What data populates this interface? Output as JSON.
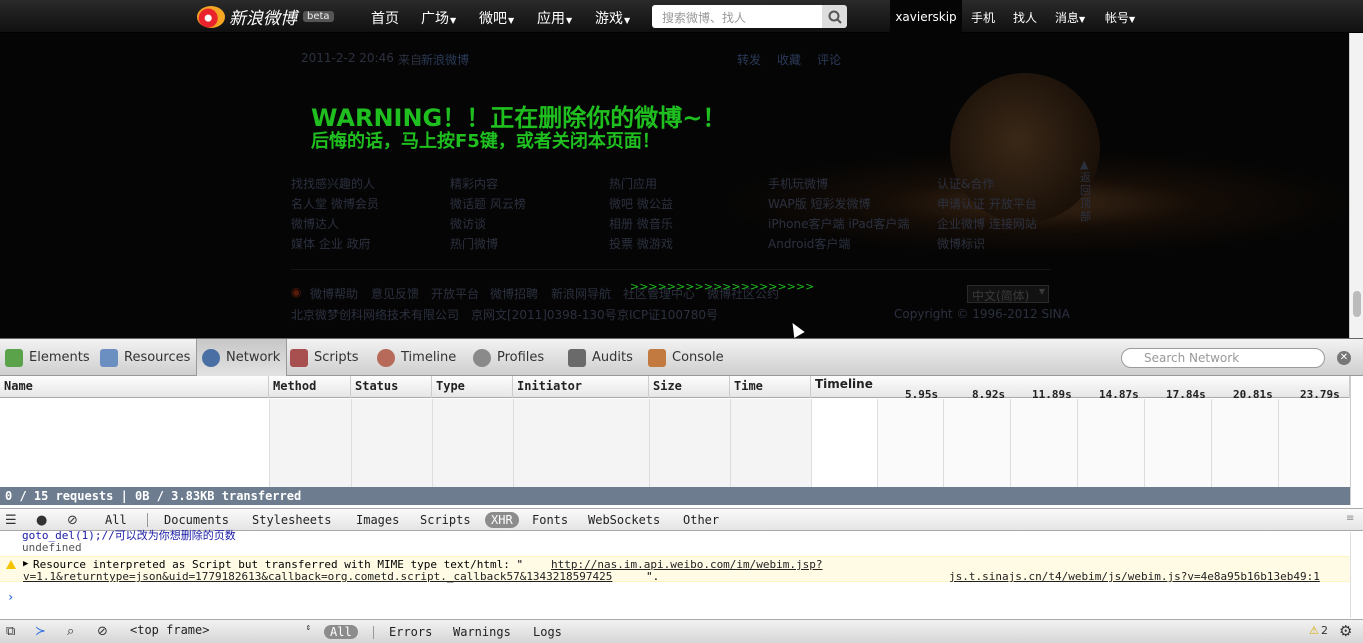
{
  "topbar": {
    "brand": "新浪微博",
    "beta": "beta",
    "nav": [
      "首页",
      "广场",
      "微吧",
      "应用",
      "游戏"
    ],
    "search_placeholder": "搜索微博、找人",
    "username": "xavierskip",
    "right_links": [
      "手机",
      "找人",
      "消息",
      "帐号"
    ]
  },
  "page": {
    "post_meta": {
      "time": "2011-2-2 20:46",
      "from_prefix": "来自",
      "from_source": "新浪微博",
      "actions": [
        "转发",
        "收藏",
        "评论"
      ]
    },
    "warning_line1": "WARNING！！正在删除你的微博~！",
    "warning_line2": "后悔的话，马上按F5键，或者关闭本页面！",
    "footer_columns": [
      {
        "title": "找找感兴趣的人",
        "lines": [
          "名人堂 微博会员",
          "微博达人",
          "媒体 企业 政府"
        ]
      },
      {
        "title": "精彩内容",
        "lines": [
          "微话题 风云榜",
          "微访谈",
          "热门微博"
        ]
      },
      {
        "title": "热门应用",
        "lines": [
          "微吧 微公益",
          "相册 微音乐",
          "投票 微游戏"
        ]
      },
      {
        "title": "手机玩微博",
        "lines": [
          "WAP版 短彩发微博",
          "iPhone客户端 iPad客户端",
          "Android客户端"
        ]
      },
      {
        "title": "认证&合作",
        "lines": [
          "申请认证 开放平台",
          "企业微博 连接网站",
          "微博标识"
        ]
      }
    ],
    "back_to_top": "返回顶部",
    "footer_links": [
      "微博帮助",
      "意见反馈",
      "开放平台",
      "微博招聘",
      "新浪网导航",
      "社区管理中心",
      "微博社区公约"
    ],
    "arrows": ">>>>>>>>>>>>>>>>>>>>",
    "language": "中文(简体)",
    "company": "北京微梦创科网络技术有限公司",
    "license1": "京网文[2011]0398-130号",
    "license2": "京ICP证100780号",
    "copyright": "Copyright © 1996-2012 SINA"
  },
  "devtools": {
    "tabs": [
      "Elements",
      "Resources",
      "Network",
      "Scripts",
      "Timeline",
      "Profiles",
      "Audits",
      "Console"
    ],
    "active_tab": "Network",
    "search_placeholder": "Search Network",
    "columns": [
      "Name",
      "Method",
      "Status",
      "Type",
      "Initiator",
      "Size",
      "Time",
      "Timeline"
    ],
    "timeline_ticks": [
      "5.95s",
      "8.92s",
      "11.89s",
      "14.87s",
      "17.84s",
      "20.81s",
      "23.79s"
    ],
    "status": "0 / 15 requests  |  0B / 3.83KB transferred",
    "filters": [
      "All",
      "Documents",
      "Stylesheets",
      "Images",
      "Scripts",
      "XHR",
      "Fonts",
      "WebSockets",
      "Other"
    ],
    "selected_filter": "XHR",
    "console": {
      "line1": "goto_del(1);//可以改为你想删除的页数",
      "line2": "undefined",
      "warn_text": "Resource interpreted as Script but transferred with MIME type text/html: \"",
      "warn_url": "http://nas.im.api.weibo.com/im/webim.jsp?v=1.1&returntype=json&uid=1779182613&callback=org.cometd.script._callback57&1343218597425",
      "warn_url_part1": "http://nas.im.api.weibo.com/im/webim.jsp?",
      "warn_url_part2": "v=1.1&returntype=json&uid=1779182613&callback=org.cometd.script._callback57&1343218597425",
      "warn_tail": "\".",
      "warn_source": "js.t.sinajs.cn/t4/webim/js/webim.js?v=4e8a95b16b13eb49:1",
      "prompt": "›"
    },
    "bottom": {
      "frame": "<top frame>",
      "filters": [
        "All",
        "Errors",
        "Warnings",
        "Logs"
      ],
      "selected": "All",
      "warning_count": "2"
    }
  }
}
